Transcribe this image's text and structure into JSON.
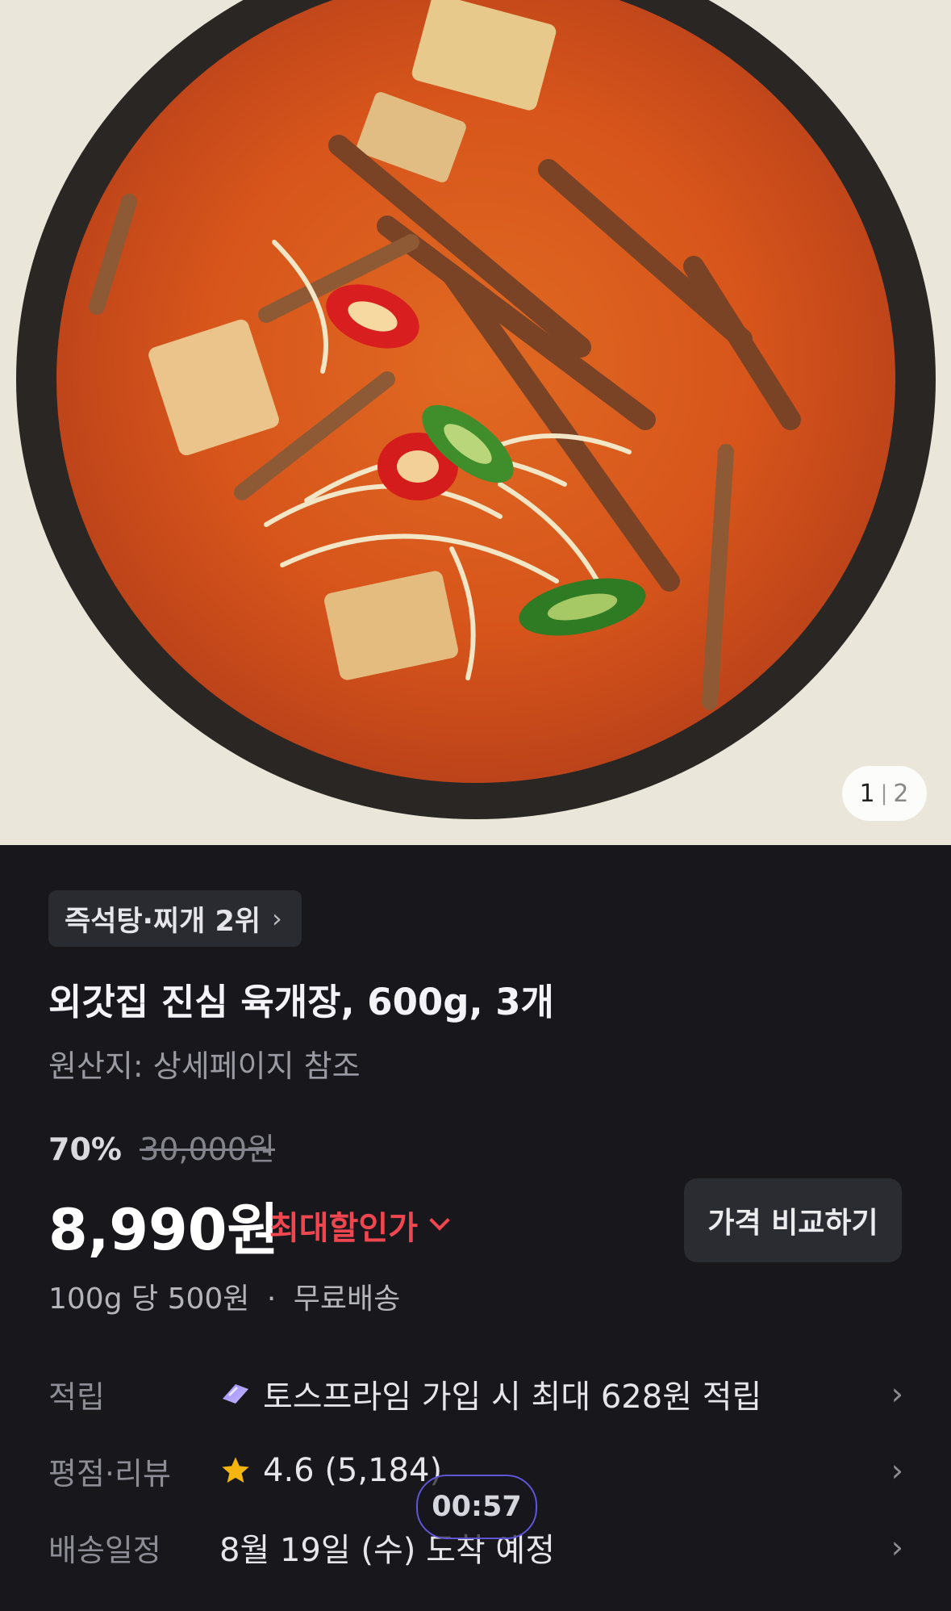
{
  "gallery": {
    "current": "1",
    "separator": "|",
    "total": "2",
    "image_icon": "product-photo-spicy-beef-soup"
  },
  "product": {
    "rank_label": "즉석탕·찌개 2위",
    "title": "외갓집 진심 육개장, 600g, 3개",
    "origin": "원산지: 상세페이지 참조",
    "discount_rate": "70%",
    "original_price": "30,000원",
    "price": "8,990원",
    "max_discount_label": "최대할인가",
    "compare_button": "가격 비교하기",
    "unit_price": "100g 당 500원",
    "dot": "·",
    "shipping": "무료배송"
  },
  "info": {
    "points": {
      "label": "적립",
      "value": "토스프라임 가입 시 최대 628원 적립",
      "icon": "toss-prime-icon"
    },
    "rating": {
      "label": "평점·리뷰",
      "value": "4.6 (5,184)",
      "icon": "star-icon"
    },
    "delivery": {
      "label": "배송일정",
      "value": "8월 19일 (수) 도착 예정"
    }
  },
  "overlay": {
    "timer": "00:57"
  },
  "colors": {
    "background": "#17171c",
    "accent_red": "#f0464f",
    "star": "#f5b50f"
  }
}
